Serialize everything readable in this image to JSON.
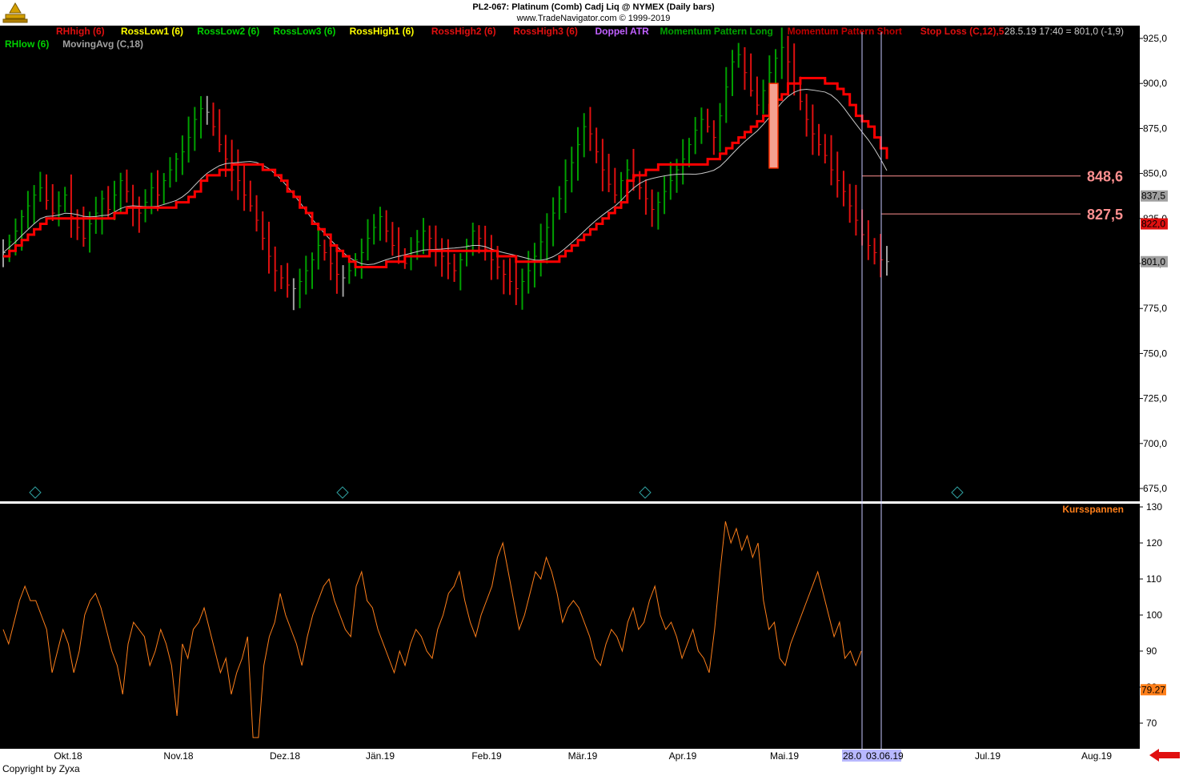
{
  "header": {
    "title": "PL2-067:  Platinum (Comb) Cadj Liq @ NYMEX  (Daily bars)",
    "source": "www.TradeNavigator.com © 1999-2019"
  },
  "footer": {
    "copyright": "Copyright by Zyxa"
  },
  "legend": {
    "items": [
      {
        "label": "RHhigh (6)",
        "color": "#e01010"
      },
      {
        "label": "RossLow1 (6)",
        "color": "#ffff00"
      },
      {
        "label": "RossLow2 (6)",
        "color": "#00d000"
      },
      {
        "label": "RossLow3 (6)",
        "color": "#00d000"
      },
      {
        "label": "RossHigh1 (6)",
        "color": "#ffff00"
      },
      {
        "label": "RossHigh2 (6)",
        "color": "#e01010"
      },
      {
        "label": "RossHigh3 (6)",
        "color": "#e01010"
      },
      {
        "label": "Doppel ATR",
        "color": "#c060ff"
      },
      {
        "label": "Momentum Pattern Long",
        "color": "#00a000"
      },
      {
        "label": "Momentum Pattern Short",
        "color": "#c00000"
      },
      {
        "label": "Stop Loss (C,12),5",
        "color": "#e01010"
      }
    ],
    "items_row2": [
      {
        "label": "RHlow (6)",
        "color": "#00d000"
      },
      {
        "label": "MovingAvg (C,18)",
        "color": "#a0a0a0"
      }
    ],
    "last_price": "28.5.19 17:40 = 801,0 (-1,9)"
  },
  "colors": {
    "background": "#000000",
    "up_bar": "#00a000",
    "down_bar": "#e01010",
    "neutral_bar": "#a0a0a0",
    "stop_line": "#ff0000",
    "moving_avg": "#c8c8c8",
    "range_line": "#ff7f1a",
    "level_line": "#ff9090"
  },
  "chart_data": [
    {
      "type": "candlestick",
      "title": "PL2-067:  Platinum (Comb) Cadj Liq @ NYMEX  (Daily bars)",
      "ylim": [
        665,
        930
      ],
      "yticks": [
        "925,0",
        "900,0",
        "875,0",
        "850,0",
        "825,0",
        "800,0",
        "775,0",
        "750,0",
        "725,0",
        "700,0",
        "675,0"
      ],
      "ytick_values": [
        925,
        900,
        875,
        850,
        825,
        800,
        775,
        750,
        725,
        700,
        675
      ],
      "xticks": [
        "Okt.18",
        "Nov.18",
        "Dez.18",
        "Jän.19",
        "Feb.19",
        "Mär.19",
        "Apr.19",
        "Mai.19",
        "Jun.19",
        "Jul.19",
        "Aug.19"
      ],
      "xtick_labels_visible": [
        "Okt.18",
        "Nov.18",
        "Dez.18",
        "Jän.19",
        "Feb.19",
        "Mär.19",
        "Apr.19",
        "Mai.19",
        "Jul.19",
        "Aug.19"
      ],
      "cursor_dates": [
        "28.0",
        "03.06.19"
      ],
      "price_labels": [
        {
          "text": "848,6",
          "value": 848.6
        },
        {
          "text": "827,5",
          "value": 827.5
        }
      ],
      "axis_badges": [
        {
          "text": "837,5",
          "value": 837.5,
          "color": "#a0a0a0"
        },
        {
          "text": "822,0",
          "value": 822.0,
          "color": "#e01010"
        },
        {
          "text": "801,0",
          "value": 801.0,
          "color": "#a0a0a0"
        }
      ],
      "bar_closes": [
        806,
        812,
        818,
        826,
        832,
        838,
        842,
        835,
        828,
        832,
        838,
        826,
        820,
        814,
        822,
        828,
        836,
        830,
        838,
        846,
        840,
        832,
        828,
        834,
        842,
        838,
        846,
        852,
        858,
        862,
        870,
        880,
        886,
        884,
        876,
        866,
        858,
        852,
        846,
        838,
        832,
        824,
        814,
        804,
        796,
        792,
        788,
        786,
        790,
        796,
        802,
        810,
        806,
        800,
        794,
        792,
        796,
        802,
        806,
        814,
        820,
        826,
        818,
        810,
        804,
        800,
        806,
        812,
        818,
        814,
        808,
        804,
        800,
        796,
        802,
        810,
        818,
        814,
        808,
        802,
        798,
        794,
        790,
        786,
        790,
        796,
        804,
        812,
        820,
        828,
        836,
        846,
        856,
        866,
        876,
        872,
        862,
        852,
        844,
        838,
        846,
        852,
        848,
        842,
        836,
        830,
        834,
        840,
        846,
        852,
        858,
        866,
        874,
        880,
        876,
        870,
        882,
        898,
        912,
        916,
        906,
        896,
        888,
        896,
        906,
        914,
        920,
        912,
        900,
        890,
        880,
        872,
        866,
        860,
        852,
        846,
        840,
        832,
        824,
        816,
        810,
        806,
        802,
        801
      ]
    },
    {
      "type": "line",
      "series": [
        {
          "name": "Kursspannen",
          "last": "79.27"
        }
      ],
      "ylim": [
        62,
        131
      ],
      "yticks": [
        "130",
        "120",
        "110",
        "100",
        "90",
        "80",
        "70"
      ],
      "ytick_values": [
        130,
        120,
        110,
        100,
        90,
        80,
        70
      ],
      "values": [
        96,
        92,
        98,
        104,
        108,
        104,
        104,
        100,
        96,
        84,
        90,
        96,
        92,
        84,
        90,
        100,
        104,
        106,
        102,
        96,
        90,
        86,
        78,
        92,
        98,
        96,
        94,
        86,
        90,
        96,
        92,
        86,
        72,
        92,
        88,
        96,
        98,
        102,
        96,
        90,
        84,
        88,
        78,
        84,
        88,
        94,
        66,
        66,
        86,
        94,
        98,
        106,
        100,
        96,
        92,
        86,
        94,
        100,
        104,
        108,
        110,
        104,
        100,
        96,
        94,
        108,
        112,
        104,
        102,
        96,
        92,
        88,
        84,
        90,
        86,
        92,
        96,
        94,
        90,
        88,
        96,
        100,
        106,
        108,
        112,
        104,
        98,
        94,
        100,
        104,
        108,
        116,
        120,
        112,
        104,
        96,
        100,
        106,
        112,
        110,
        116,
        112,
        106,
        98,
        102,
        104,
        102,
        98,
        94,
        88,
        86,
        92,
        96,
        94,
        90,
        98,
        102,
        96,
        98,
        104,
        108,
        100,
        96,
        98,
        94,
        88,
        92,
        96,
        90,
        88,
        84,
        96,
        112,
        126,
        120,
        124,
        118,
        122,
        116,
        120,
        104,
        96,
        98,
        88,
        86,
        92,
        96,
        100,
        104,
        108,
        112,
        106,
        100,
        94,
        98,
        88,
        90,
        86,
        90
      ]
    }
  ]
}
